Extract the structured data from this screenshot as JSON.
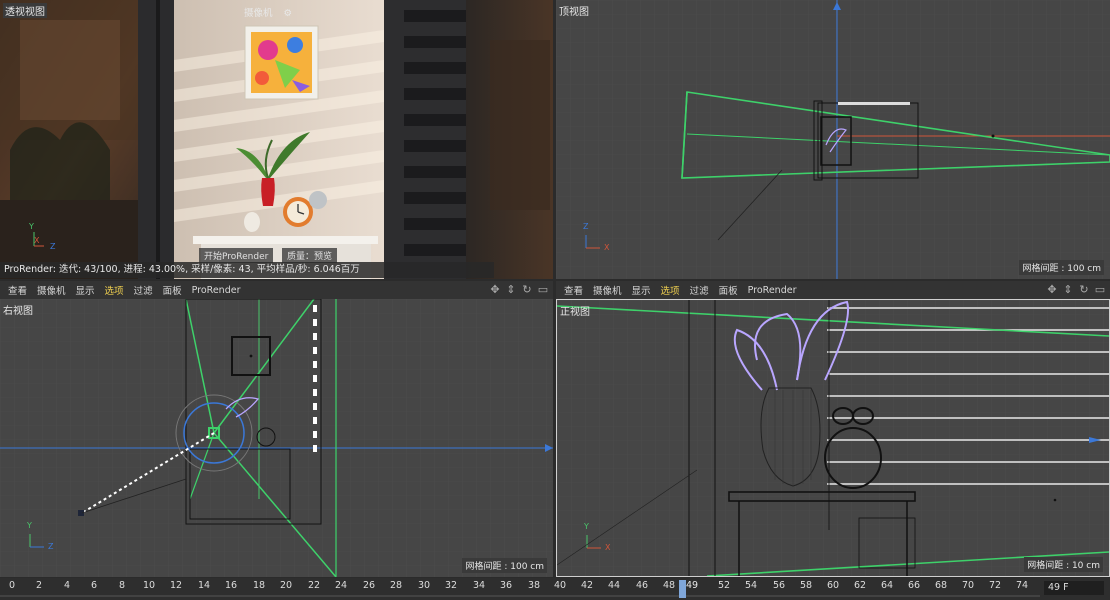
{
  "viewports": {
    "perspective": {
      "title": "透视视图",
      "camera_label": "摄像机",
      "render_button": "开始ProRender",
      "quality_label": "质量：预览",
      "status": "ProRender: 迭代: 43/100, 进程: 43.00%, 采样/像素: 43, 平均样品/秒: 6.046百万",
      "axis": {
        "y": "Y",
        "x": "X",
        "z": "Z"
      }
    },
    "top": {
      "title": "顶视图",
      "grid_label": "网格间距 : 100 cm",
      "axis": {
        "z": "Z",
        "x": "X"
      }
    },
    "right": {
      "title": "右视图",
      "grid_label": "网格间距 : 100 cm",
      "axis": {
        "y": "Y",
        "z": "Z"
      }
    },
    "front": {
      "title": "正视图",
      "grid_label": "网格间距 : 10 cm",
      "axis": {
        "y": "Y",
        "x": "X"
      }
    }
  },
  "menu": {
    "left": [
      "查看",
      "摄像机",
      "显示",
      "选项",
      "过滤",
      "面板",
      "ProRender"
    ],
    "right": [
      "查看",
      "摄像机",
      "显示",
      "选项",
      "过滤",
      "面板",
      "ProRender"
    ],
    "active": "选项",
    "icons": [
      "move-icon",
      "scale-icon",
      "rotate-icon",
      "maximize-icon"
    ]
  },
  "timeline": {
    "ticks": [
      "0",
      "2",
      "4",
      "6",
      "8",
      "10",
      "12",
      "14",
      "16",
      "18",
      "20",
      "22",
      "24",
      "26",
      "28",
      "30",
      "32",
      "34",
      "36",
      "38",
      "40",
      "42",
      "44",
      "46",
      "48",
      "49",
      "52",
      "54",
      "56",
      "58",
      "60",
      "62",
      "64",
      "66",
      "68",
      "70",
      "72",
      "74"
    ],
    "current_frame": "49",
    "frame_field": "49 F"
  },
  "colors": {
    "viewport_bg": "#464646",
    "camera_frustum": "#3ed16a",
    "wireframe_selected": "#b9a6ff",
    "axis_x": "#d0553a",
    "axis_y": "#49c46a",
    "axis_z": "#3b78d8",
    "active_menu": "#f0d050"
  }
}
